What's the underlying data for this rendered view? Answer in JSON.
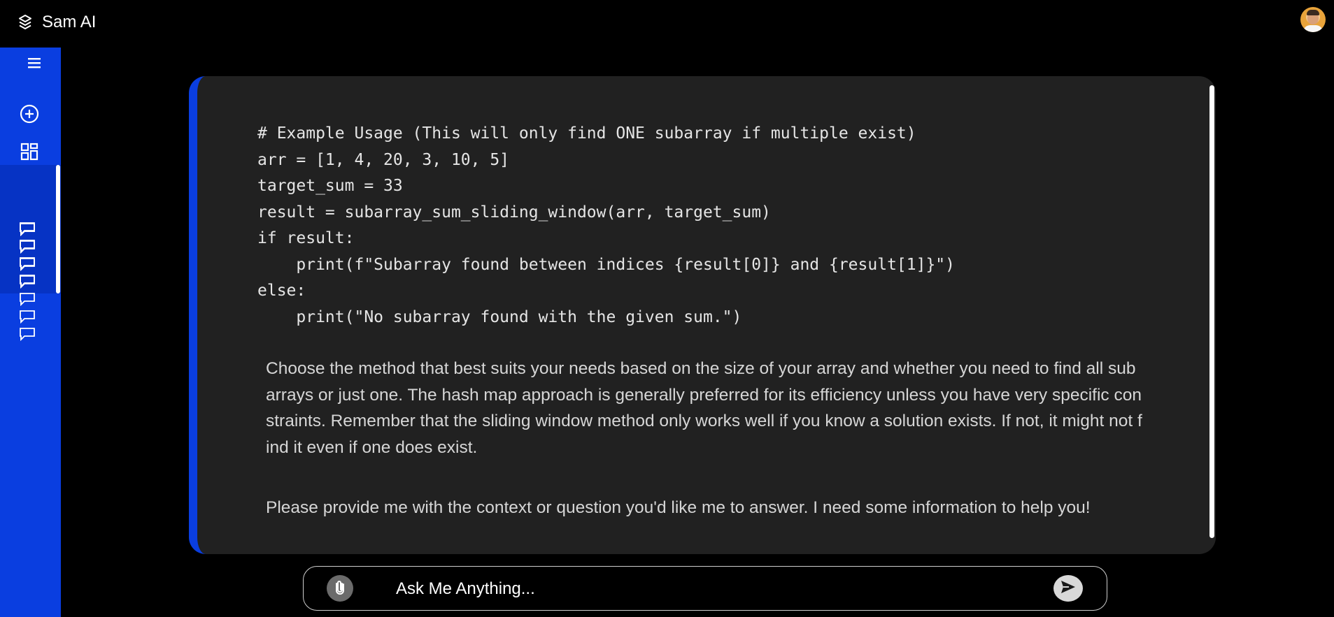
{
  "app": {
    "title": "Sam AI"
  },
  "header": {
    "avatar_alt": "user avatar"
  },
  "sidebar": {
    "buttons": [
      {
        "icon": "menu-icon"
      },
      {
        "icon": "new-chat-icon"
      },
      {
        "icon": "dashboard-icon"
      },
      {
        "icon": "contact-icon"
      }
    ],
    "history_count": 7
  },
  "conversation": {
    "code_lines": [
      "# Example Usage (This will only find ONE subarray if multiple exist)",
      "arr = [1, 4, 20, 3, 10, 5]",
      "target_sum = 33",
      "result = subarray_sum_sliding_window(arr, target_sum)",
      "if result:",
      "    print(f\"Subarray found between indices {result[0]} and {result[1]}\")",
      "else:",
      "    print(\"No subarray found with the given sum.\")"
    ],
    "paragraph_1": "Choose the method that best suits your needs based on the size of your array and whether you need to find all subarrays or just one. The hash map approach is generally preferred for its efficiency unless you have very specific constraints. Remember that the sliding window method only works well if you know a solution exists. If not, it might not find it even if one does exist.",
    "paragraph_2": "Please provide me with the context or question you'd like me to answer. I need some information to help you!"
  },
  "composer": {
    "placeholder": "Ask Me Anything..."
  },
  "colors": {
    "accent": "#0a3ee0",
    "background": "#000000",
    "card": "#212121"
  }
}
